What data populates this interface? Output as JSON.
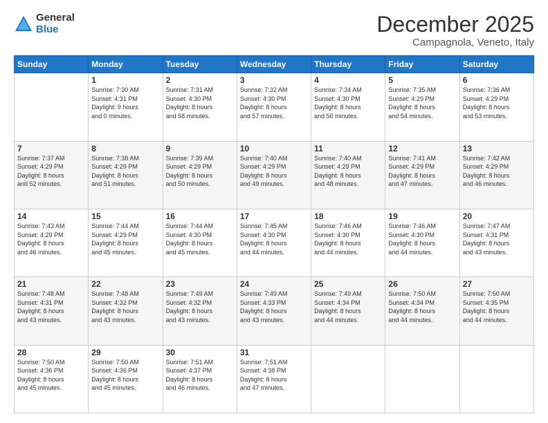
{
  "logo": {
    "general": "General",
    "blue": "Blue"
  },
  "header": {
    "month": "December 2025",
    "location": "Campagnola, Veneto, Italy"
  },
  "weekdays": [
    "Sunday",
    "Monday",
    "Tuesday",
    "Wednesday",
    "Thursday",
    "Friday",
    "Saturday"
  ],
  "weeks": [
    [
      {
        "day": "",
        "info": ""
      },
      {
        "day": "1",
        "info": "Sunrise: 7:30 AM\nSunset: 4:31 PM\nDaylight: 9 hours\nand 0 minutes."
      },
      {
        "day": "2",
        "info": "Sunrise: 7:31 AM\nSunset: 4:30 PM\nDaylight: 8 hours\nand 58 minutes."
      },
      {
        "day": "3",
        "info": "Sunrise: 7:32 AM\nSunset: 4:30 PM\nDaylight: 8 hours\nand 57 minutes."
      },
      {
        "day": "4",
        "info": "Sunrise: 7:34 AM\nSunset: 4:30 PM\nDaylight: 8 hours\nand 56 minutes."
      },
      {
        "day": "5",
        "info": "Sunrise: 7:35 AM\nSunset: 4:29 PM\nDaylight: 8 hours\nand 54 minutes."
      },
      {
        "day": "6",
        "info": "Sunrise: 7:36 AM\nSunset: 4:29 PM\nDaylight: 8 hours\nand 53 minutes."
      }
    ],
    [
      {
        "day": "7",
        "info": "Sunrise: 7:37 AM\nSunset: 4:29 PM\nDaylight: 8 hours\nand 52 minutes."
      },
      {
        "day": "8",
        "info": "Sunrise: 7:38 AM\nSunset: 4:29 PM\nDaylight: 8 hours\nand 51 minutes."
      },
      {
        "day": "9",
        "info": "Sunrise: 7:39 AM\nSunset: 4:29 PM\nDaylight: 8 hours\nand 50 minutes."
      },
      {
        "day": "10",
        "info": "Sunrise: 7:40 AM\nSunset: 4:29 PM\nDaylight: 8 hours\nand 49 minutes."
      },
      {
        "day": "11",
        "info": "Sunrise: 7:40 AM\nSunset: 4:29 PM\nDaylight: 8 hours\nand 48 minutes."
      },
      {
        "day": "12",
        "info": "Sunrise: 7:41 AM\nSunset: 4:29 PM\nDaylight: 8 hours\nand 47 minutes."
      },
      {
        "day": "13",
        "info": "Sunrise: 7:42 AM\nSunset: 4:29 PM\nDaylight: 8 hours\nand 46 minutes."
      }
    ],
    [
      {
        "day": "14",
        "info": "Sunrise: 7:43 AM\nSunset: 4:29 PM\nDaylight: 8 hours\nand 46 minutes."
      },
      {
        "day": "15",
        "info": "Sunrise: 7:44 AM\nSunset: 4:29 PM\nDaylight: 8 hours\nand 45 minutes."
      },
      {
        "day": "16",
        "info": "Sunrise: 7:44 AM\nSunset: 4:30 PM\nDaylight: 8 hours\nand 45 minutes."
      },
      {
        "day": "17",
        "info": "Sunrise: 7:45 AM\nSunset: 4:30 PM\nDaylight: 8 hours\nand 44 minutes."
      },
      {
        "day": "18",
        "info": "Sunrise: 7:46 AM\nSunset: 4:30 PM\nDaylight: 8 hours\nand 44 minutes."
      },
      {
        "day": "19",
        "info": "Sunrise: 7:46 AM\nSunset: 4:30 PM\nDaylight: 8 hours\nand 44 minutes."
      },
      {
        "day": "20",
        "info": "Sunrise: 7:47 AM\nSunset: 4:31 PM\nDaylight: 8 hours\nand 43 minutes."
      }
    ],
    [
      {
        "day": "21",
        "info": "Sunrise: 7:48 AM\nSunset: 4:31 PM\nDaylight: 8 hours\nand 43 minutes."
      },
      {
        "day": "22",
        "info": "Sunrise: 7:48 AM\nSunset: 4:32 PM\nDaylight: 8 hours\nand 43 minutes."
      },
      {
        "day": "23",
        "info": "Sunrise: 7:49 AM\nSunset: 4:32 PM\nDaylight: 8 hours\nand 43 minutes."
      },
      {
        "day": "24",
        "info": "Sunrise: 7:49 AM\nSunset: 4:33 PM\nDaylight: 8 hours\nand 43 minutes."
      },
      {
        "day": "25",
        "info": "Sunrise: 7:49 AM\nSunset: 4:34 PM\nDaylight: 8 hours\nand 44 minutes."
      },
      {
        "day": "26",
        "info": "Sunrise: 7:50 AM\nSunset: 4:34 PM\nDaylight: 8 hours\nand 44 minutes."
      },
      {
        "day": "27",
        "info": "Sunrise: 7:50 AM\nSunset: 4:35 PM\nDaylight: 8 hours\nand 44 minutes."
      }
    ],
    [
      {
        "day": "28",
        "info": "Sunrise: 7:50 AM\nSunset: 4:36 PM\nDaylight: 8 hours\nand 45 minutes."
      },
      {
        "day": "29",
        "info": "Sunrise: 7:50 AM\nSunset: 4:36 PM\nDaylight: 8 hours\nand 45 minutes."
      },
      {
        "day": "30",
        "info": "Sunrise: 7:51 AM\nSunset: 4:37 PM\nDaylight: 8 hours\nand 46 minutes."
      },
      {
        "day": "31",
        "info": "Sunrise: 7:51 AM\nSunset: 4:38 PM\nDaylight: 8 hours\nand 47 minutes."
      },
      {
        "day": "",
        "info": ""
      },
      {
        "day": "",
        "info": ""
      },
      {
        "day": "",
        "info": ""
      }
    ]
  ]
}
